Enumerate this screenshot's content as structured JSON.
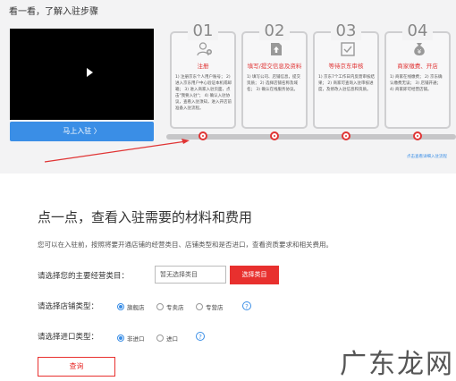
{
  "header": {
    "title": "看一看，了解入驻步骤"
  },
  "video": {
    "play_icon": "play-icon"
  },
  "enter_button": {
    "label": "马上入驻 〉"
  },
  "steps": [
    {
      "num": "01",
      "title": "注册",
      "desc": "1) 注册京东个人用户账号； 2) 进入京东用户中心验证本机或邮箱； 3) 进入商家入驻页面，点击\"我要入驻\"； 4) 确认入驻协议，查看入驻须知，进入开店前准备入驻流程。"
    },
    {
      "num": "02",
      "title": "填写/提交信息及资料",
      "desc": "1) 填写公司、店铺信息，提交资质； 2) 选择店铺名称及域名； 3) 确认在线服务协议。"
    },
    {
      "num": "03",
      "title": "等待京东审核",
      "desc": "1) 京东7个工作日内反馈审核结果； 2) 商家可查询入驻审核进度，及修改入驻信息和资质。"
    },
    {
      "num": "04",
      "title": "商家缴费、开店",
      "desc": "1) 商家在线缴费； 2) 京东确认缴费无误； 3) 店铺开通； 4) 商家即可经营店铺。"
    }
  ],
  "note": "点击查看详细入驻流程",
  "section": {
    "title": "点一点，查看入驻需要的材料和费用",
    "desc": "您可以在入驻前，按照将要开通店铺的经营类目、店铺类型和是否进口，查看资质要求和相关费用。"
  },
  "category": {
    "label": "请选择您的主要经营类目：",
    "placeholder": "暂无选择类目",
    "button": "选择类目"
  },
  "store_type": {
    "label": "请选择店铺类型：",
    "options": [
      "旗舰店",
      "专卖店",
      "专营店"
    ]
  },
  "import_type": {
    "label": "请选择进口类型：",
    "options": [
      "非进口",
      "进口"
    ]
  },
  "help_mark": "?",
  "query_button": "查询",
  "watermark": "广东龙网"
}
